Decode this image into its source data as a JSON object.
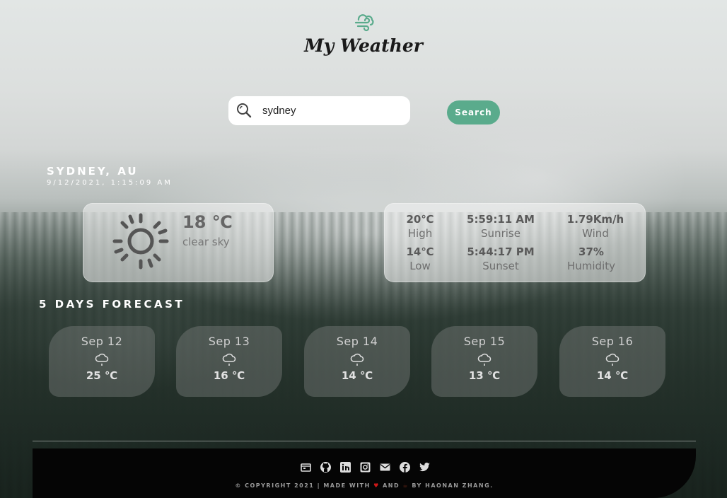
{
  "app": {
    "title": "My Weather"
  },
  "search": {
    "value": "sydney",
    "placeholder": "",
    "button_label": "Search"
  },
  "location": {
    "city": "SYDNEY, AU",
    "datetime": "9/12/2021, 1:15:09 AM"
  },
  "current": {
    "temp": "18 ℃",
    "description": "clear sky",
    "icon": "sun-icon"
  },
  "details": {
    "high": {
      "value": "20℃",
      "label": "High"
    },
    "low": {
      "value": "14℃",
      "label": "Low"
    },
    "sunrise": {
      "value": "5:59:11 AM",
      "label": "Sunrise"
    },
    "sunset": {
      "value": "5:44:17 PM",
      "label": "Sunset"
    },
    "wind": {
      "value": "1.79Km/h",
      "label": "Wind"
    },
    "humidity": {
      "value": "37%",
      "label": "Humidity"
    }
  },
  "forecast": {
    "title": "5 DAYS FORECAST",
    "days": [
      {
        "date": "Sep 12",
        "temp": "25 ℃",
        "icon": "cloud-icon"
      },
      {
        "date": "Sep 13",
        "temp": "16 ℃",
        "icon": "cloud-icon"
      },
      {
        "date": "Sep 14",
        "temp": "14 ℃",
        "icon": "cloud-icon"
      },
      {
        "date": "Sep 15",
        "temp": "13 ℃",
        "icon": "cloud-icon"
      },
      {
        "date": "Sep 16",
        "temp": "14 ℃",
        "icon": "cloud-icon"
      }
    ]
  },
  "footer": {
    "copyright_pre": "© COPYRIGHT 2021 | MADE WITH",
    "heart": "♥",
    "and": "AND",
    "coffee": "☕",
    "copyright_post": "BY HAONAN ZHANG.",
    "social": [
      "portfolio-icon",
      "github-icon",
      "linkedin-icon",
      "instagram-icon",
      "email-icon",
      "facebook-icon",
      "twitter-icon"
    ]
  },
  "colors": {
    "accent": "#5aab8c",
    "heart": "#d01818",
    "footer_bg": "#050505"
  }
}
